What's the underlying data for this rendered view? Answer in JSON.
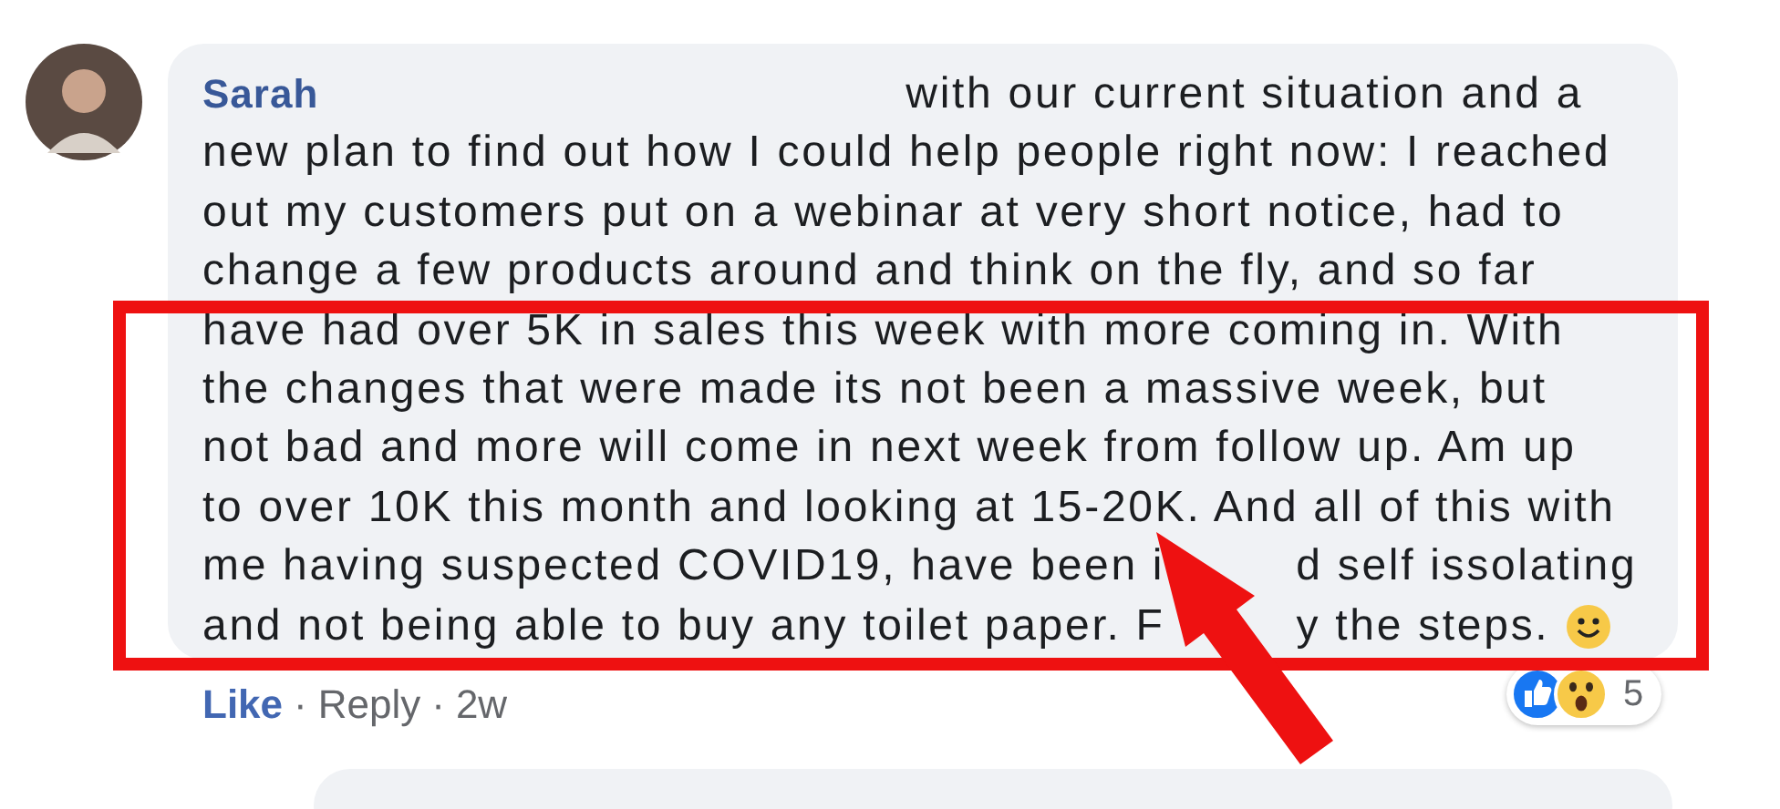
{
  "comment": {
    "author": "Sarah",
    "lead": "with our current situation and a",
    "lines": [
      {
        "parts": [
          "new plan to find out how I could help people right now: I reached"
        ]
      },
      {
        "parts": [
          "out my customers put on a webinar at very short notice, had to"
        ]
      },
      {
        "parts": [
          "change a few products around and think on the fly, and so far"
        ]
      },
      {
        "parts": [
          "have had over 5K in sales this week with more coming in. With"
        ]
      },
      {
        "parts": [
          "the changes that were made its not been a massive week, but"
        ]
      },
      {
        "parts": [
          "not bad and more will come in next week from follow up. Am up"
        ]
      },
      {
        "parts": [
          "to over 10K this month and looking at 15-20K. And all of this with"
        ]
      },
      {
        "parts": [
          "me having suspected COVID19, have been i",
          "d self issolating"
        ]
      },
      {
        "parts": [
          "and not being able to buy any toilet paper. F",
          "y the steps."
        ]
      }
    ]
  },
  "actions": [
    {
      "label": "Like",
      "kind": "like"
    },
    {
      "label": "·",
      "kind": "separator"
    },
    {
      "label": "Reply",
      "kind": "reply"
    },
    {
      "label": "·",
      "kind": "separator"
    },
    {
      "label": "2w",
      "kind": "time"
    }
  ],
  "reactions": {
    "count": "5"
  }
}
